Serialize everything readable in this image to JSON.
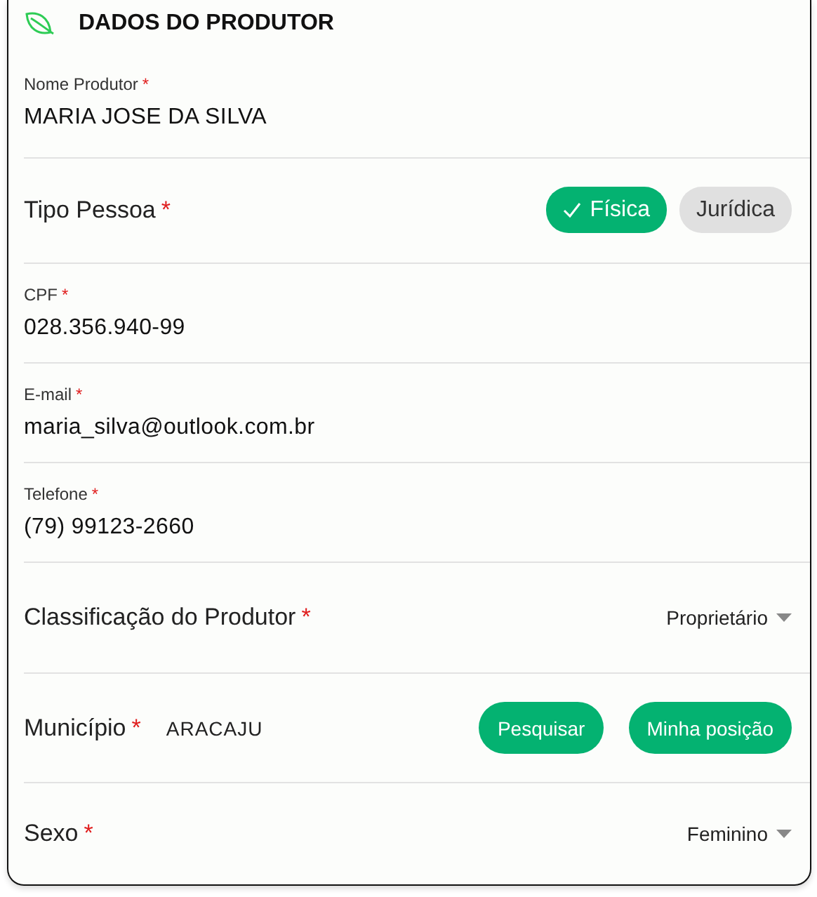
{
  "header": {
    "title": "DADOS DO PRODUTOR"
  },
  "fields": [
    {
      "kind": "text",
      "label": "Nome Produtor",
      "required_mark": "*",
      "value": "MARIA JOSE DA SILVA"
    },
    {
      "kind": "chips",
      "label": "Tipo Pessoa",
      "required_mark": "*",
      "options": [
        {
          "label": "Física",
          "selected": true
        },
        {
          "label": "Jurídica",
          "selected": false
        }
      ]
    },
    {
      "kind": "text",
      "label": "CPF",
      "required_mark": "*",
      "value": "028.356.940-99"
    },
    {
      "kind": "text",
      "label": "E-mail",
      "required_mark": "*",
      "value": "maria_silva@outlook.com.br"
    },
    {
      "kind": "text",
      "label": "Telefone",
      "required_mark": "*",
      "value": "(79) 99123-2660"
    },
    {
      "kind": "dropdown",
      "label": "Classificação do Produtor",
      "required_mark": "*",
      "value": "Proprietário"
    },
    {
      "kind": "search",
      "label": "Município",
      "required_mark": "*",
      "value": "ARACAJU",
      "buttons": [
        "Pesquisar",
        "Minha posição"
      ]
    },
    {
      "kind": "dropdown",
      "label": "Sexo",
      "required_mark": "*",
      "value": "Feminino"
    }
  ]
}
